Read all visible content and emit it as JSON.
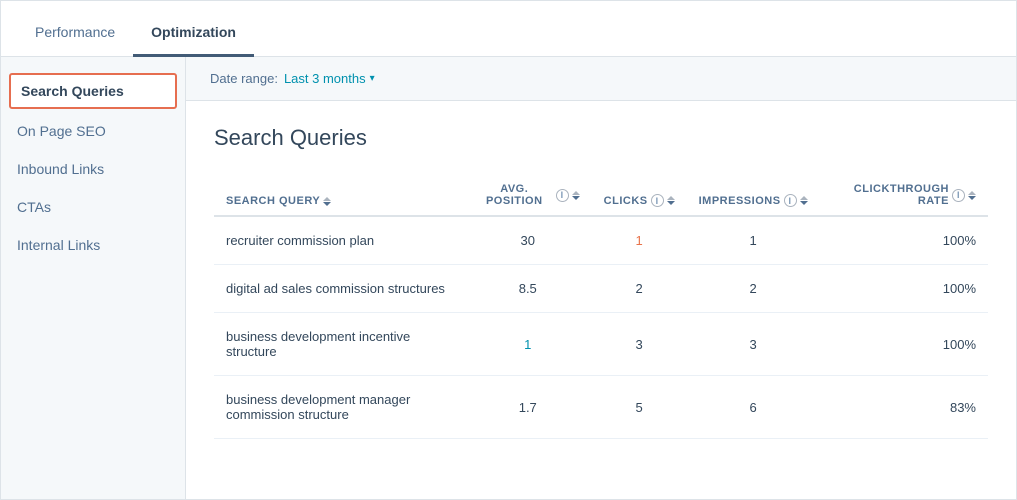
{
  "tabs": [
    {
      "id": "performance",
      "label": "Performance",
      "active": false
    },
    {
      "id": "optimization",
      "label": "Optimization",
      "active": true
    }
  ],
  "sidebar": {
    "items": [
      {
        "id": "search-queries",
        "label": "Search Queries",
        "active": true
      },
      {
        "id": "on-page-seo",
        "label": "On Page SEO",
        "active": false
      },
      {
        "id": "inbound-links",
        "label": "Inbound Links",
        "active": false
      },
      {
        "id": "ctas",
        "label": "CTAs",
        "active": false
      },
      {
        "id": "internal-links",
        "label": "Internal Links",
        "active": false
      }
    ]
  },
  "date_range": {
    "label": "Date range:",
    "value": "Last 3 months"
  },
  "table": {
    "title": "Search Queries",
    "columns": [
      {
        "id": "search-query",
        "label": "SEARCH QUERY",
        "sortable": true,
        "align": "left"
      },
      {
        "id": "avg-position",
        "label": "AVG. POSITION",
        "sortable": true,
        "info": true,
        "align": "center"
      },
      {
        "id": "clicks",
        "label": "CLICKS",
        "sortable": true,
        "info": true,
        "align": "center"
      },
      {
        "id": "impressions",
        "label": "IMPRESSIONS",
        "sortable": true,
        "info": true,
        "align": "center"
      },
      {
        "id": "clickthrough-rate",
        "label": "CLICKTHROUGH RATE",
        "sortable": true,
        "info": true,
        "align": "right",
        "active_sort": true
      }
    ],
    "rows": [
      {
        "search_query": "recruiter commission plan",
        "avg_position": "30",
        "avg_position_link": false,
        "clicks": "1",
        "clicks_highlight": true,
        "impressions": "1",
        "clickthrough_rate": "100%"
      },
      {
        "search_query": "digital ad sales commission structures",
        "avg_position": "8.5",
        "avg_position_link": false,
        "clicks": "2",
        "clicks_highlight": false,
        "impressions": "2",
        "clickthrough_rate": "100%"
      },
      {
        "search_query": "business development incentive structure",
        "avg_position": "1",
        "avg_position_link": true,
        "clicks": "3",
        "clicks_highlight": false,
        "impressions": "3",
        "clickthrough_rate": "100%"
      },
      {
        "search_query": "business development manager commis­sion structure",
        "avg_position": "1.7",
        "avg_position_link": false,
        "clicks": "5",
        "clicks_highlight": false,
        "impressions": "6",
        "clickthrough_rate": "83%"
      }
    ]
  }
}
